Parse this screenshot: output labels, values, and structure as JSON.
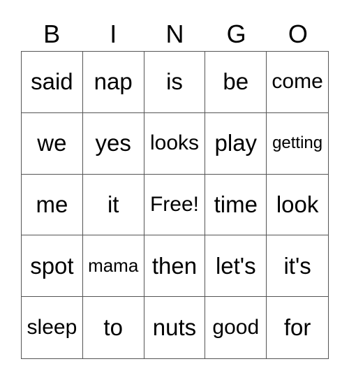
{
  "card": {
    "header": [
      "B",
      "I",
      "N",
      "G",
      "O"
    ],
    "rows": [
      [
        "said",
        "nap",
        "is",
        "be",
        "come"
      ],
      [
        "we",
        "yes",
        "looks",
        "play",
        "getting"
      ],
      [
        "me",
        "it",
        "Free!",
        "time",
        "look"
      ],
      [
        "spot",
        "mama",
        "then",
        "let's",
        "it's"
      ],
      [
        "sleep",
        "to",
        "nuts",
        "good",
        "for"
      ]
    ],
    "free_space": "Free!"
  }
}
